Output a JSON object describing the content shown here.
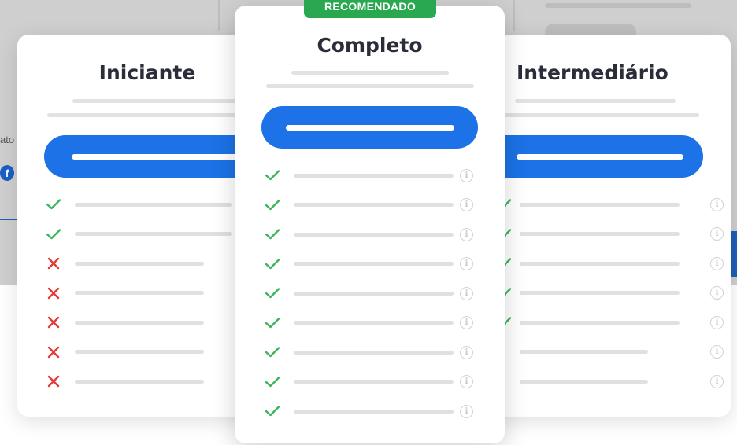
{
  "background": {
    "side_text": "ato",
    "facebook_glyph": "f"
  },
  "plans": {
    "left": {
      "title": "Iniciante",
      "features": [
        "check",
        "check",
        "cross",
        "cross",
        "cross",
        "cross",
        "cross"
      ]
    },
    "center": {
      "title": "Completo",
      "badge": "RECOMENDADO",
      "features": [
        "check",
        "check",
        "check",
        "check",
        "check",
        "check",
        "check",
        "check",
        "check"
      ]
    },
    "right": {
      "title": "Intermediário",
      "features": [
        "check",
        "check",
        "check",
        "check",
        "check",
        "none",
        "none"
      ]
    }
  },
  "colors": {
    "check": "#3ab55a",
    "cross": "#e53935",
    "cta": "#1c72e6",
    "badge": "#2aa84f"
  },
  "icons": {
    "check": "check-icon",
    "cross": "cross-icon",
    "info": "info-icon",
    "facebook": "facebook-icon"
  }
}
